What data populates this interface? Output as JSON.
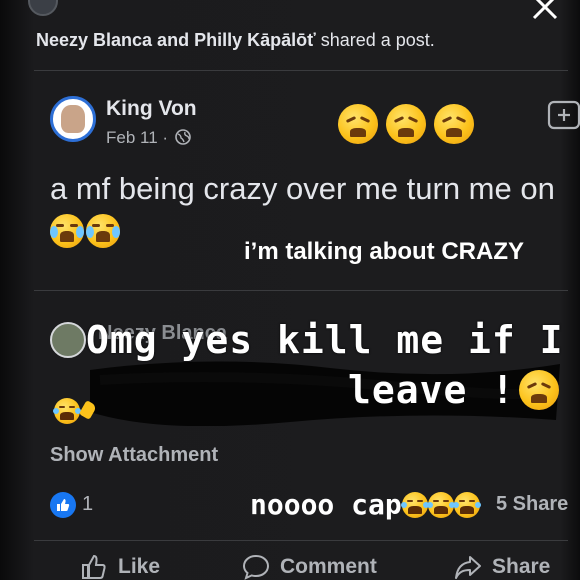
{
  "header": {
    "shared_prefix_names": "Neezy Blanca and Philly Kāpālōť",
    "shared_suffix": " shared a post."
  },
  "post": {
    "author": "King Von",
    "date": "Feb 11 · ",
    "text": "a mf being crazy over me turn me on"
  },
  "overlays": {
    "caption": "i’m talking about CRAZY",
    "omg": "Omg yes kill me if I",
    "leave": "leave !",
    "nocap": "noooo cap"
  },
  "comment": {
    "author_partial": "Neezy Blanca"
  },
  "attachment": {
    "label": "Show Attachment"
  },
  "reactions": {
    "like_count": "1",
    "shares_partial": "5 Share"
  },
  "actions": {
    "like": "Like",
    "comment": "Comment",
    "share": "Share"
  },
  "colors": {
    "background": "#1c1c1e",
    "like_blue": "#1877f2",
    "avatar_ring": "#2d6fd6",
    "text_primary": "#e4e6eb",
    "text_secondary": "#b0b3b8"
  }
}
